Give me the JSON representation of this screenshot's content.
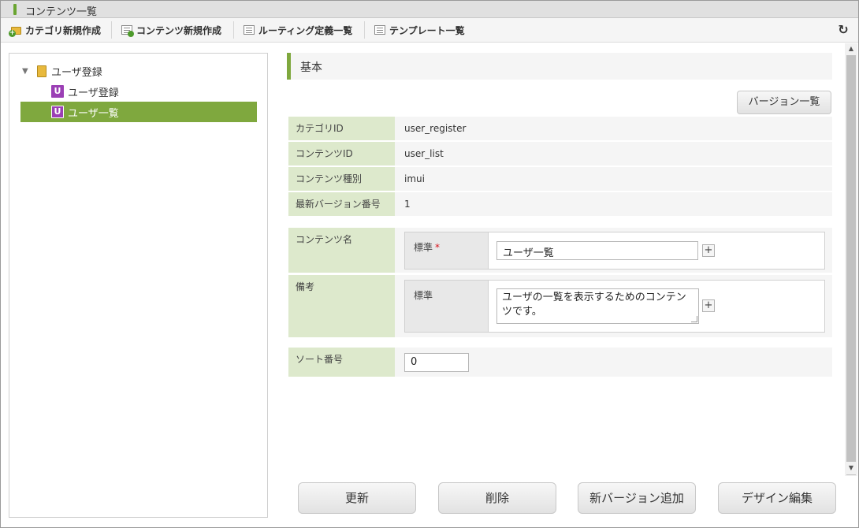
{
  "window": {
    "title": "コンテンツ一覧"
  },
  "toolbar": {
    "new_category": "カテゴリ新規作成",
    "new_content": "コンテンツ新規作成",
    "routing_list": "ルーティング定義一覧",
    "template_list": "テンプレート一覧",
    "refresh_icon": "refresh-icon"
  },
  "tree": {
    "folder_label": "ユーザ登録",
    "items": [
      {
        "label": "ユーザ登録",
        "icon": "U"
      },
      {
        "label": "ユーザ一覧",
        "icon": "U",
        "selected": true
      }
    ]
  },
  "section": {
    "title": "基本"
  },
  "version_list_button": "バージョン一覧",
  "info": [
    {
      "label": "カテゴリID",
      "value": "user_register"
    },
    {
      "label": "コンテンツID",
      "value": "user_list"
    },
    {
      "label": "コンテンツ種別",
      "value": "imui"
    },
    {
      "label": "最新バージョン番号",
      "value": "1"
    }
  ],
  "form": {
    "content_name": {
      "label": "コンテンツ名",
      "lang_label": "標準",
      "required_mark": "*",
      "value": "ユーザ一覧"
    },
    "note": {
      "label": "備考",
      "lang_label": "標準",
      "value": "ユーザの一覧を表示するためのコンテンツです。"
    },
    "sort": {
      "label": "ソート番号",
      "value": "0"
    },
    "add_symbol": "+"
  },
  "buttons": {
    "update": "更新",
    "delete": "削除",
    "add_version": "新バージョン追加",
    "edit_design": "デザイン編集"
  },
  "colors": {
    "accent": "#7fa83e",
    "label_bg": "#dde9cc",
    "u_icon": "#9b3fb5"
  }
}
